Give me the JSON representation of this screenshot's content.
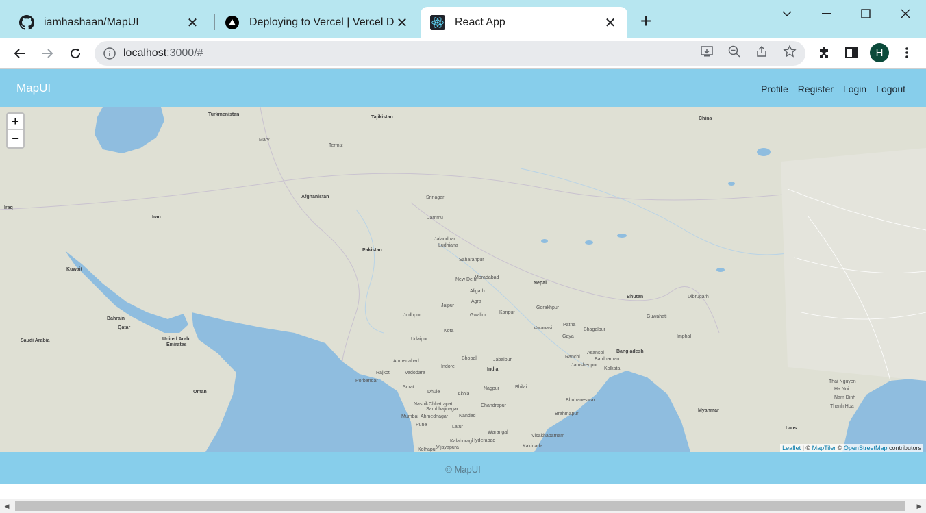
{
  "browser": {
    "tabs": [
      {
        "title": "iamhashaan/MapUI",
        "icon": "github-icon"
      },
      {
        "title": "Deploying to Vercel | Vercel Docs",
        "icon": "vercel-icon"
      },
      {
        "title": "React App",
        "icon": "react-icon",
        "active": true
      }
    ],
    "url_host": "localhost",
    "url_rest": ":3000/#",
    "profile_initial": "H"
  },
  "navbar": {
    "brand": "MapUI",
    "links": [
      "Profile",
      "Register",
      "Login",
      "Logout"
    ]
  },
  "map": {
    "zoom_in": "+",
    "zoom_out": "−",
    "attribution": {
      "leaflet": "Leaflet",
      "sep1": " | © ",
      "maptiler": "MapTiler",
      "sep2": " © ",
      "osm": "OpenStreetMap",
      "tail": " contributors"
    },
    "labels": [
      {
        "text": "Turkmenistan",
        "big": true
      },
      {
        "text": "Tajikistan",
        "big": true
      },
      {
        "text": "China",
        "big": true
      },
      {
        "text": "Afghanistan",
        "big": true
      },
      {
        "text": "Iran",
        "big": true
      },
      {
        "text": "Iraq",
        "big": true
      },
      {
        "text": "Pakistan",
        "big": true
      },
      {
        "text": "Kuwait",
        "big": true
      },
      {
        "text": "Nepal",
        "big": true
      },
      {
        "text": "Bhutan",
        "big": true
      },
      {
        "text": "Bahrain",
        "big": true
      },
      {
        "text": "Qatar",
        "big": true
      },
      {
        "text": "Saudi Arabia",
        "big": true
      },
      {
        "text": "United Arab",
        "big": true
      },
      {
        "text": "Emirates",
        "big": true
      },
      {
        "text": "India",
        "big": true
      },
      {
        "text": "Bangladesh",
        "big": true
      },
      {
        "text": "Oman",
        "big": true
      },
      {
        "text": "Myanmar",
        "big": true
      },
      {
        "text": "Laos",
        "big": true
      },
      {
        "text": "Mary",
        "big": false
      },
      {
        "text": "Termiz",
        "big": false
      },
      {
        "text": "Srinagar",
        "big": false
      },
      {
        "text": "Jammu",
        "big": false
      },
      {
        "text": "Jalandhar",
        "big": false
      },
      {
        "text": "Ludhiana",
        "big": false
      },
      {
        "text": "Saharanpur",
        "big": false
      },
      {
        "text": "New Delhi",
        "big": false
      },
      {
        "text": "Moradabad",
        "big": false
      },
      {
        "text": "Aligarh",
        "big": false
      },
      {
        "text": "Agra",
        "big": false
      },
      {
        "text": "Jaipur",
        "big": false
      },
      {
        "text": "Gwalior",
        "big": false
      },
      {
        "text": "Kanpur",
        "big": false
      },
      {
        "text": "Gorakhpur",
        "big": false
      },
      {
        "text": "Patna",
        "big": false
      },
      {
        "text": "Varanasi",
        "big": false
      },
      {
        "text": "Gaya",
        "big": false
      },
      {
        "text": "Bhagalpur",
        "big": false
      },
      {
        "text": "Jodhpur",
        "big": false
      },
      {
        "text": "Kota",
        "big": false
      },
      {
        "text": "Udaipur",
        "big": false
      },
      {
        "text": "Ahmedabad",
        "big": false
      },
      {
        "text": "Bhopal",
        "big": false
      },
      {
        "text": "Jabalpur",
        "big": false
      },
      {
        "text": "Indore",
        "big": false
      },
      {
        "text": "Ranchi",
        "big": false
      },
      {
        "text": "Jamshedpur",
        "big": false
      },
      {
        "text": "Asansol",
        "big": false
      },
      {
        "text": "Bardhaman",
        "big": false
      },
      {
        "text": "Kolkata",
        "big": false
      },
      {
        "text": "Rajkot",
        "big": false
      },
      {
        "text": "Vadodara",
        "big": false
      },
      {
        "text": "Porbandar",
        "big": false
      },
      {
        "text": "Surat",
        "big": false
      },
      {
        "text": "Dhule",
        "big": false
      },
      {
        "text": "Akola",
        "big": false
      },
      {
        "text": "Nagpur",
        "big": false
      },
      {
        "text": "Bhilai",
        "big": false
      },
      {
        "text": "Nashik",
        "big": false
      },
      {
        "text": "Chhatrapati",
        "big": false
      },
      {
        "text": "Sambhajinagar",
        "big": false
      },
      {
        "text": "Chandrapur",
        "big": false
      },
      {
        "text": "Mumbai",
        "big": false
      },
      {
        "text": "Ahmednagar",
        "big": false
      },
      {
        "text": "Nanded",
        "big": false
      },
      {
        "text": "Pune",
        "big": false
      },
      {
        "text": "Latur",
        "big": false
      },
      {
        "text": "Warangal",
        "big": false
      },
      {
        "text": "Kalaburagi",
        "big": false
      },
      {
        "text": "Hyderabad",
        "big": false
      },
      {
        "text": "Kolhapur",
        "big": false
      },
      {
        "text": "Vijayapura",
        "big": false
      },
      {
        "text": "Bhubaneswar",
        "big": false
      },
      {
        "text": "Brahmapur",
        "big": false
      },
      {
        "text": "Visakhapatnam",
        "big": false
      },
      {
        "text": "Kakinada",
        "big": false
      },
      {
        "text": "Imphal",
        "big": false
      },
      {
        "text": "Guwahati",
        "big": false
      },
      {
        "text": "Dibrugarh",
        "big": false
      },
      {
        "text": "Thai Nguyen",
        "big": false
      },
      {
        "text": "Ha Noi",
        "big": false
      },
      {
        "text": "Nam Dinh",
        "big": false
      },
      {
        "text": "Thanh Hoa",
        "big": false
      }
    ]
  },
  "footer": {
    "text": "© MapUI"
  }
}
